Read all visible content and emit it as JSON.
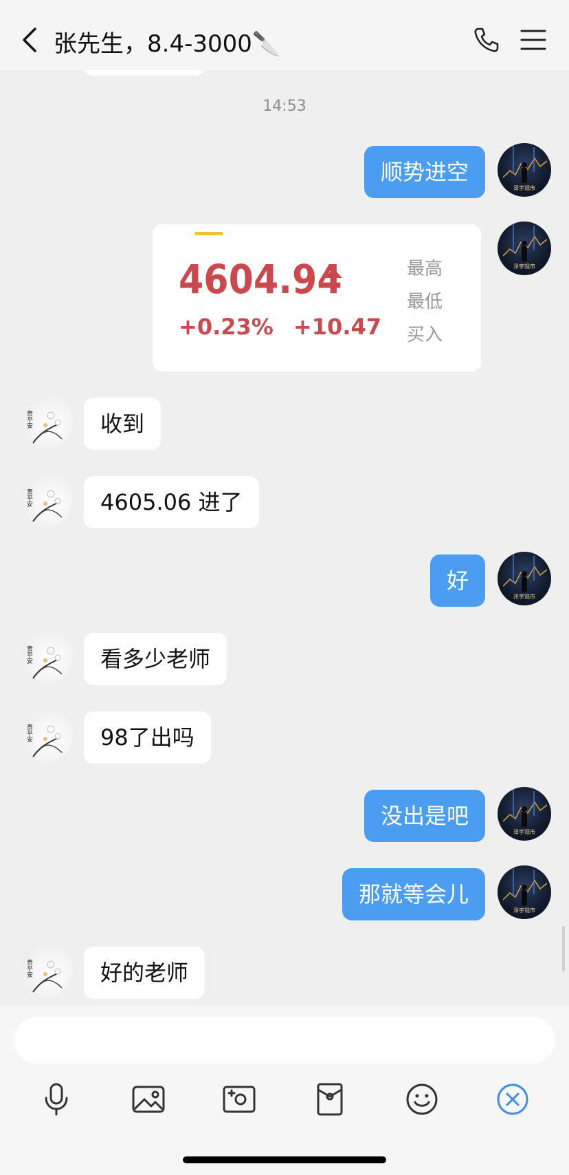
{
  "header": {
    "title": "张先生，8.4-3000🔪"
  },
  "timestamp": "14:53",
  "stock_card": {
    "price": "4604.94",
    "change_percent": "+0.23%",
    "change_value": "+10.47",
    "labels": [
      "最高",
      "最低",
      "买入"
    ]
  },
  "messages": [
    {
      "side": "right",
      "text": "顺势进空"
    },
    {
      "side": "left",
      "text": "收到"
    },
    {
      "side": "left",
      "text": "4605.06 进了"
    },
    {
      "side": "right",
      "text": "好"
    },
    {
      "side": "left",
      "text": "看多少老师"
    },
    {
      "side": "left",
      "text": "98了出吗"
    },
    {
      "side": "right",
      "text": "没出是吧"
    },
    {
      "side": "right",
      "text": "那就等会儿"
    },
    {
      "side": "left",
      "text": "好的老师"
    }
  ],
  "avatars": {
    "self_label": "泽宇观市",
    "peer_label": "贵平安"
  },
  "colors": {
    "bubble_self": "#4a9df0",
    "bubble_peer": "#ffffff",
    "price_red": "#c9494f",
    "accent_yellow": "#f2c12e",
    "cancel_blue": "#3d8ee8"
  },
  "toolbar": {
    "icons": [
      "microphone-icon",
      "image-icon",
      "camera-icon",
      "red-packet-icon",
      "emoji-icon",
      "close-circle-icon"
    ]
  }
}
